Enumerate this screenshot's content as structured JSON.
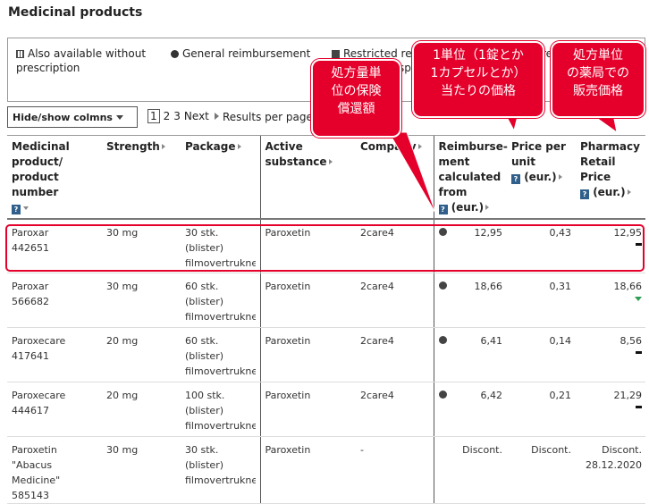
{
  "page_title": "Medicinal products",
  "legend": {
    "no_rx_line1": "Also available without",
    "no_rx_line2": "prescription",
    "general": "General reimbursement",
    "restricted": "Restricted rei",
    "fragment_spec": "spec",
    "fragment_re": "re"
  },
  "controls": {
    "hide_show": "Hide/show colmns",
    "pages": [
      "1",
      "2",
      "3"
    ],
    "next": "Next",
    "results_per": "Results per page"
  },
  "columns": {
    "product": [
      "Medicinal",
      "product/",
      "product",
      "number"
    ],
    "strength": "Strength",
    "package": "Package",
    "active": [
      "Active",
      "substance"
    ],
    "company": "Company",
    "reimb": [
      "Reimburse-",
      "ment",
      "calculated",
      "from",
      "(eur.)"
    ],
    "ppu": [
      "Price per",
      "unit",
      "(eur.)"
    ],
    "retail": [
      "Pharmacy",
      "Retail Price",
      "(eur.)"
    ]
  },
  "help_glyph": "?",
  "rows": [
    {
      "name": "Paroxar",
      "number": "442651",
      "strength": "30 mg",
      "pkg1": "30 stk.",
      "pkg2": "(blister)",
      "pkg3": "filmovertrukne",
      "active": "Paroxetin",
      "company": "2care4",
      "reimb": "12,95",
      "ppu": "0,43",
      "retail": "12,95",
      "trend": "flat"
    },
    {
      "name": "Paroxar",
      "number": "566682",
      "strength": "30 mg",
      "pkg1": "60 stk.",
      "pkg2": "(blister)",
      "pkg3": "filmovertrukne",
      "active": "Paroxetin",
      "company": "2care4",
      "reimb": "18,66",
      "ppu": "0,31",
      "retail": "18,66",
      "trend": "down"
    },
    {
      "name": "Paroxecare",
      "number": "417641",
      "strength": "20 mg",
      "pkg1": "60 stk.",
      "pkg2": "(blister)",
      "pkg3": "filmovertrukne",
      "active": "Paroxetin",
      "company": "2care4",
      "reimb": "6,41",
      "ppu": "0,14",
      "retail": "8,56",
      "trend": "flat"
    },
    {
      "name": "Paroxecare",
      "number": "444617",
      "strength": "20 mg",
      "pkg1": "100 stk.",
      "pkg2": "(blister)",
      "pkg3": "filmovertrukne",
      "active": "Paroxetin",
      "company": "2care4",
      "reimb": "6,42",
      "ppu": "0,21",
      "retail": "21,29",
      "trend": "flat"
    },
    {
      "name1": "Paroxetin \"Abacus",
      "name2": "Medicine\"",
      "number": "585143",
      "strength": "30 mg",
      "pkg1": "30 stk.",
      "pkg2": "(blister)",
      "pkg3": "filmovertrukne",
      "active": "Paroxetin",
      "company": "-",
      "reimb": "Discont.",
      "ppu": "Discont.",
      "retail": "Discont.",
      "retail_date": "28.12.2020"
    }
  ],
  "callouts": {
    "reimb": [
      "処方量単",
      "位の保険",
      "償還額"
    ],
    "unit": [
      "1単位（1錠とか",
      "1カプセルとか）",
      "当たりの価格"
    ],
    "retail": [
      "処方単位",
      "の薬局での",
      "販売価格"
    ]
  },
  "colors": {
    "accent_red": "#e5002b",
    "trend_green": "#2e9e55",
    "help_blue": "#2f5f8a"
  }
}
